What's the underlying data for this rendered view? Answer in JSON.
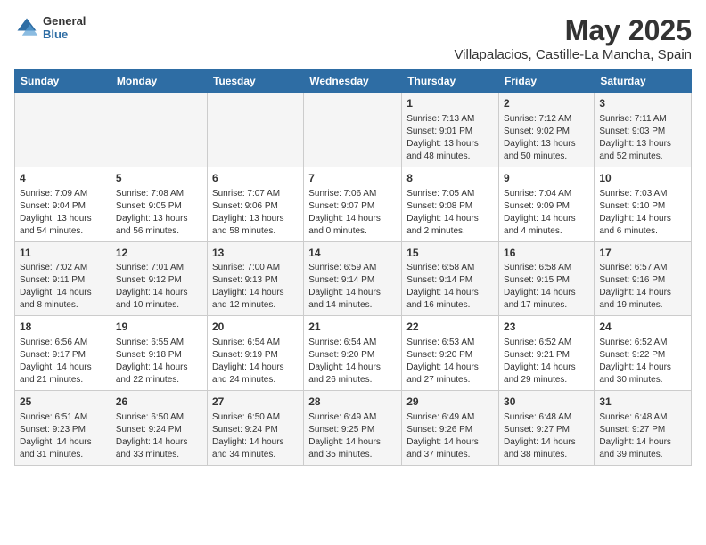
{
  "logo": {
    "general": "General",
    "blue": "Blue"
  },
  "title": "May 2025",
  "subtitle": "Villapalacios, Castille-La Mancha, Spain",
  "headers": [
    "Sunday",
    "Monday",
    "Tuesday",
    "Wednesday",
    "Thursday",
    "Friday",
    "Saturday"
  ],
  "weeks": [
    [
      {
        "day": "",
        "content": ""
      },
      {
        "day": "",
        "content": ""
      },
      {
        "day": "",
        "content": ""
      },
      {
        "day": "",
        "content": ""
      },
      {
        "day": "1",
        "content": "Sunrise: 7:13 AM\nSunset: 9:01 PM\nDaylight: 13 hours\nand 48 minutes."
      },
      {
        "day": "2",
        "content": "Sunrise: 7:12 AM\nSunset: 9:02 PM\nDaylight: 13 hours\nand 50 minutes."
      },
      {
        "day": "3",
        "content": "Sunrise: 7:11 AM\nSunset: 9:03 PM\nDaylight: 13 hours\nand 52 minutes."
      }
    ],
    [
      {
        "day": "4",
        "content": "Sunrise: 7:09 AM\nSunset: 9:04 PM\nDaylight: 13 hours\nand 54 minutes."
      },
      {
        "day": "5",
        "content": "Sunrise: 7:08 AM\nSunset: 9:05 PM\nDaylight: 13 hours\nand 56 minutes."
      },
      {
        "day": "6",
        "content": "Sunrise: 7:07 AM\nSunset: 9:06 PM\nDaylight: 13 hours\nand 58 minutes."
      },
      {
        "day": "7",
        "content": "Sunrise: 7:06 AM\nSunset: 9:07 PM\nDaylight: 14 hours\nand 0 minutes."
      },
      {
        "day": "8",
        "content": "Sunrise: 7:05 AM\nSunset: 9:08 PM\nDaylight: 14 hours\nand 2 minutes."
      },
      {
        "day": "9",
        "content": "Sunrise: 7:04 AM\nSunset: 9:09 PM\nDaylight: 14 hours\nand 4 minutes."
      },
      {
        "day": "10",
        "content": "Sunrise: 7:03 AM\nSunset: 9:10 PM\nDaylight: 14 hours\nand 6 minutes."
      }
    ],
    [
      {
        "day": "11",
        "content": "Sunrise: 7:02 AM\nSunset: 9:11 PM\nDaylight: 14 hours\nand 8 minutes."
      },
      {
        "day": "12",
        "content": "Sunrise: 7:01 AM\nSunset: 9:12 PM\nDaylight: 14 hours\nand 10 minutes."
      },
      {
        "day": "13",
        "content": "Sunrise: 7:00 AM\nSunset: 9:13 PM\nDaylight: 14 hours\nand 12 minutes."
      },
      {
        "day": "14",
        "content": "Sunrise: 6:59 AM\nSunset: 9:14 PM\nDaylight: 14 hours\nand 14 minutes."
      },
      {
        "day": "15",
        "content": "Sunrise: 6:58 AM\nSunset: 9:14 PM\nDaylight: 14 hours\nand 16 minutes."
      },
      {
        "day": "16",
        "content": "Sunrise: 6:58 AM\nSunset: 9:15 PM\nDaylight: 14 hours\nand 17 minutes."
      },
      {
        "day": "17",
        "content": "Sunrise: 6:57 AM\nSunset: 9:16 PM\nDaylight: 14 hours\nand 19 minutes."
      }
    ],
    [
      {
        "day": "18",
        "content": "Sunrise: 6:56 AM\nSunset: 9:17 PM\nDaylight: 14 hours\nand 21 minutes."
      },
      {
        "day": "19",
        "content": "Sunrise: 6:55 AM\nSunset: 9:18 PM\nDaylight: 14 hours\nand 22 minutes."
      },
      {
        "day": "20",
        "content": "Sunrise: 6:54 AM\nSunset: 9:19 PM\nDaylight: 14 hours\nand 24 minutes."
      },
      {
        "day": "21",
        "content": "Sunrise: 6:54 AM\nSunset: 9:20 PM\nDaylight: 14 hours\nand 26 minutes."
      },
      {
        "day": "22",
        "content": "Sunrise: 6:53 AM\nSunset: 9:20 PM\nDaylight: 14 hours\nand 27 minutes."
      },
      {
        "day": "23",
        "content": "Sunrise: 6:52 AM\nSunset: 9:21 PM\nDaylight: 14 hours\nand 29 minutes."
      },
      {
        "day": "24",
        "content": "Sunrise: 6:52 AM\nSunset: 9:22 PM\nDaylight: 14 hours\nand 30 minutes."
      }
    ],
    [
      {
        "day": "25",
        "content": "Sunrise: 6:51 AM\nSunset: 9:23 PM\nDaylight: 14 hours\nand 31 minutes."
      },
      {
        "day": "26",
        "content": "Sunrise: 6:50 AM\nSunset: 9:24 PM\nDaylight: 14 hours\nand 33 minutes."
      },
      {
        "day": "27",
        "content": "Sunrise: 6:50 AM\nSunset: 9:24 PM\nDaylight: 14 hours\nand 34 minutes."
      },
      {
        "day": "28",
        "content": "Sunrise: 6:49 AM\nSunset: 9:25 PM\nDaylight: 14 hours\nand 35 minutes."
      },
      {
        "day": "29",
        "content": "Sunrise: 6:49 AM\nSunset: 9:26 PM\nDaylight: 14 hours\nand 37 minutes."
      },
      {
        "day": "30",
        "content": "Sunrise: 6:48 AM\nSunset: 9:27 PM\nDaylight: 14 hours\nand 38 minutes."
      },
      {
        "day": "31",
        "content": "Sunrise: 6:48 AM\nSunset: 9:27 PM\nDaylight: 14 hours\nand 39 minutes."
      }
    ]
  ]
}
